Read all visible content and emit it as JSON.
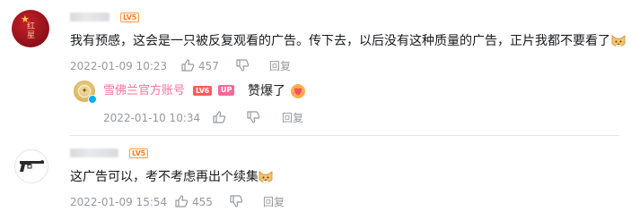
{
  "comments": [
    {
      "level_badge": "LV5",
      "text": "我有预感，这会是一只被反复观看的广告。传下去，以后没有这种质量的广告，正片我都不要看了",
      "time": "2022-01-09 10:23",
      "likes": "457",
      "reply_label": "回复",
      "avatar_glyphs": "红星",
      "replies": [
        {
          "name": "雪佛兰官方账号",
          "level_badge": "LV6",
          "up_badge": "UP",
          "text": "赞爆了",
          "time": "2022-01-10 10:34",
          "reply_label": "回复"
        }
      ]
    },
    {
      "level_badge": "LV5",
      "text": "这广告可以，考不考虑再出个续集",
      "time": "2022-01-09 15:54",
      "likes": "455",
      "reply_label": "回复"
    }
  ],
  "colors": {
    "accent_name": "#fb7299",
    "meta_gray": "#9499a0",
    "level_orange": "#ff7a1a",
    "up_pink": "#ff6699",
    "verify_blue": "#00aeec"
  },
  "icons": [
    "avatar-red-flag",
    "avatar-gun-icon",
    "avatar-chevrolet-badge",
    "thumbs-up-icon",
    "thumbs-down-icon",
    "dog-emoji",
    "heart-emoji"
  ]
}
